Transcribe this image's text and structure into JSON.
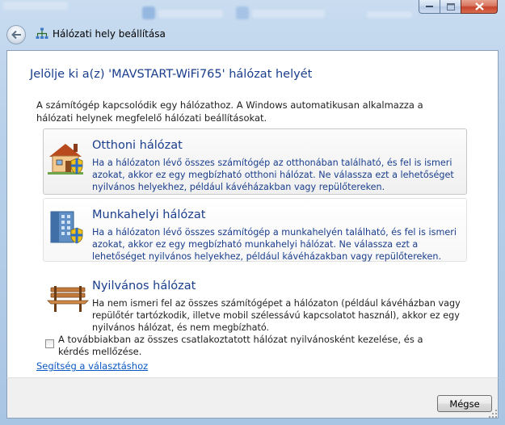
{
  "window": {
    "title": "Hálózati hely beállítása",
    "caption_buttons": [
      "minimize-icon",
      "maximize-icon",
      "close-icon"
    ]
  },
  "content": {
    "heading": "Jelölje ki a(z) 'MAVSTART-WiFi765' hálózat helyét",
    "intro": "A számítógép kapcsolódik egy hálózathoz. A Windows automatikusan alkalmazza a hálózati helynek megfelelő hálózati beállításokat."
  },
  "options": [
    {
      "title": "Otthoni hálózat",
      "description": "Ha a hálózaton lévő összes számítógép az otthonában található, és fel is ismeri azokat, akkor ez egy megbízható otthoni hálózat. Ne válassza ezt a lehetőséget nyilvános helyekhez, például kávéházakban vagy repülőtereken.",
      "icon": "home-network-icon"
    },
    {
      "title": "Munkahelyi hálózat",
      "description": "Ha a hálózaton lévő összes számítógép a munkahelyén található, és fel is ismeri azokat, akkor ez egy megbízható munkahelyi hálózat. Ne válassza ezt a lehetőséget nyilvános helyekhez, például kávéházakban vagy repülőtereken.",
      "icon": "work-network-icon"
    },
    {
      "title": "Nyilvános hálózat",
      "description": "Ha nem ismeri fel az összes számítógépet a hálózaton (például kávéházban vagy repülőtér tartózkodik, illetve mobil szélessávú kapcsolatot használ), akkor ez egy nyilvános hálózat, és nem megbízható.",
      "icon": "public-network-icon"
    }
  ],
  "checkbox": {
    "label": "A továbbiakban az összes csatlakoztatott hálózat nyilvánosként kezelése, és a kérdés mellőzése.",
    "checked": false
  },
  "help_link": "Segítség a választáshoz",
  "footer": {
    "cancel_label": "Mégse"
  },
  "colors": {
    "heading": "#1a3e8c",
    "link": "#0a57c2",
    "glass": "#b9d1ea"
  }
}
